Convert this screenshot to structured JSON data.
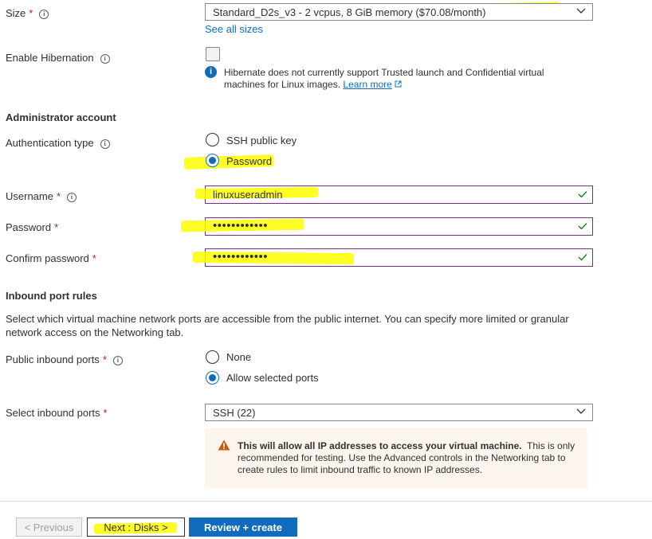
{
  "size": {
    "label": "Size",
    "required": "*",
    "value": "Standard_D2s_v3 - 2 vcpus, 8 GiB memory ($70.08/month)",
    "see_all": "See all sizes"
  },
  "hibernation": {
    "label": "Enable Hibernation",
    "info_text": "Hibernate does not currently support Trusted launch and Confidential virtual",
    "info_text2": "machines for Linux images.",
    "learn_more": "Learn more"
  },
  "admin": {
    "heading": "Administrator account",
    "auth_label": "Authentication type",
    "options": [
      "SSH public key",
      "Password"
    ],
    "selected": "Password",
    "username_label": "Username",
    "username_value": "linuxuseradmin",
    "password_label": "Password",
    "password_value": "••••••••••••",
    "confirm_label": "Confirm password",
    "confirm_value": "••••••••••••",
    "required": "*"
  },
  "inbound": {
    "heading": "Inbound port rules",
    "description1": "Select which virtual machine network ports are accessible from the public internet. You can specify more limited or granular",
    "description2": "network access on the Networking tab.",
    "public_label": "Public inbound ports",
    "public_options": [
      "None",
      "Allow selected ports"
    ],
    "public_selected": "Allow selected ports",
    "select_label": "Select inbound ports",
    "select_value": "SSH (22)",
    "warning_bold": "This will allow all IP addresses to access your virtual machine.",
    "warning_rest1": "This is only",
    "warning_rest2": "recommended for testing.  Use the Advanced controls in the Networking tab to",
    "warning_rest3": "create rules to limit inbound traffic to known IP addresses.",
    "required": "*"
  },
  "footer": {
    "previous": "< Previous",
    "next": "Next : Disks >",
    "review": "Review + create"
  },
  "colors": {
    "accent": "#0f6cbd",
    "required": "#a4262c",
    "valid_check": "#107c10",
    "highlight": "#ffff00",
    "warning_bg": "#fdf6ee"
  }
}
